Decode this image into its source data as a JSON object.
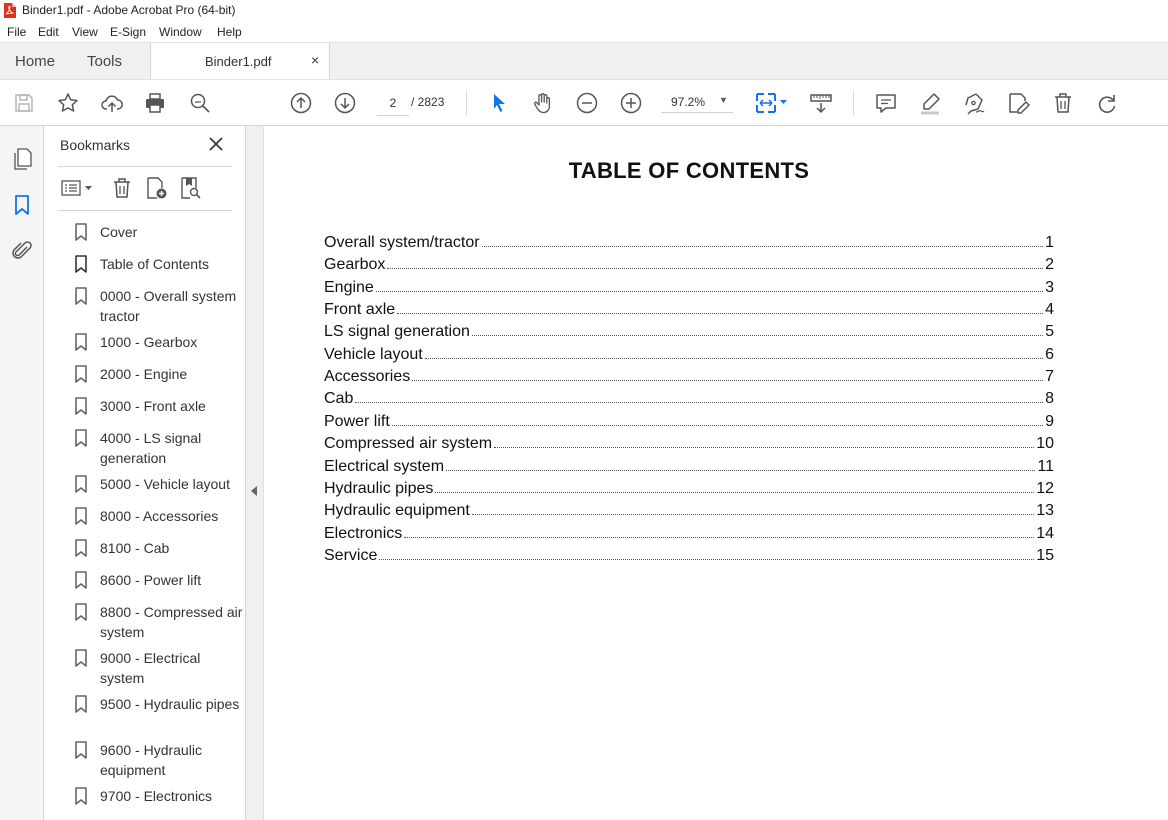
{
  "window": {
    "title": "Binder1.pdf - Adobe Acrobat Pro (64-bit)"
  },
  "menu": [
    "File",
    "Edit",
    "View",
    "E-Sign",
    "Window",
    "Help"
  ],
  "tabs": {
    "home": "Home",
    "tools": "Tools",
    "document": "Binder1.pdf",
    "close": "×"
  },
  "toolbar": {
    "page_current": "2",
    "page_total": "/  2823",
    "zoom": "97.2%",
    "icons": [
      "save-icon",
      "star-icon",
      "upload-icon",
      "print-icon",
      "search-zoom-icon",
      "page-up-icon",
      "page-down-icon",
      "select-arrow-icon",
      "hand-icon",
      "zoom-out-icon",
      "zoom-in-icon",
      "fit-page-icon",
      "scroll-mode-icon",
      "comment-icon",
      "highlight-icon",
      "sign-icon",
      "edit-pdf-icon",
      "delete-icon",
      "redo-icon"
    ]
  },
  "bookmarks_panel": {
    "title": "Bookmarks",
    "items": [
      "Cover",
      "Table of Contents",
      "0000 - Overall system tractor",
      "1000 - Gearbox",
      "2000 - Engine",
      "3000 - Front axle",
      "4000 - LS signal generation",
      "5000 - Vehicle layout",
      "8000 - Accessories",
      "8100 - Cab",
      "8600 - Power lift",
      "8800 - Compressed air system",
      "9000 - Electrical system",
      "9500 - Hydraulic pipes",
      "9600 - Hydraulic equipment",
      "9700 - Electronics"
    ]
  },
  "document": {
    "title": "TABLE OF CONTENTS",
    "entries": [
      {
        "label": "Overall system/tractor",
        "page": "1"
      },
      {
        "label": "Gearbox",
        "page": "2"
      },
      {
        "label": "Engine",
        "page": "3"
      },
      {
        "label": "Front axle",
        "page": "4"
      },
      {
        "label": "LS signal generation",
        "page": "5"
      },
      {
        "label": "Vehicle layout",
        "page": "6"
      },
      {
        "label": "Accessories",
        "page": "7"
      },
      {
        "label": "Cab",
        "page": "8"
      },
      {
        "label": "Power lift",
        "page": "9"
      },
      {
        "label": "Compressed air system",
        "page": "10"
      },
      {
        "label": "Electrical system",
        "page": "11"
      },
      {
        "label": "Hydraulic pipes",
        "page": "12"
      },
      {
        "label": "Hydraulic equipment",
        "page": "13"
      },
      {
        "label": "Electronics",
        "page": "14"
      },
      {
        "label": "Service",
        "page": "15"
      }
    ]
  },
  "colors": {
    "accent_blue": "#1473e6",
    "pdf_red": "#e0301e"
  }
}
